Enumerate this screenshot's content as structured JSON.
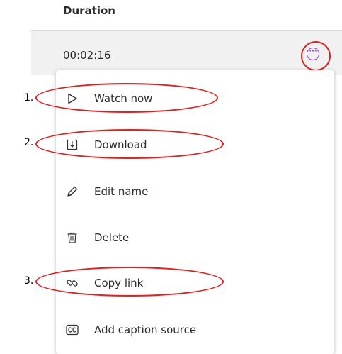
{
  "table": {
    "column_header": "Duration",
    "row": {
      "duration": "00:02:16"
    }
  },
  "menu": {
    "items": [
      {
        "label": "Watch now",
        "icon": "play-icon"
      },
      {
        "label": "Download",
        "icon": "download-icon"
      },
      {
        "label": "Edit name",
        "icon": "pencil-icon"
      },
      {
        "label": "Delete",
        "icon": "trash-icon"
      },
      {
        "label": "Copy link",
        "icon": "link-icon"
      },
      {
        "label": "Add caption source",
        "icon": "closed-caption-icon"
      }
    ]
  },
  "annotations": {
    "steps": [
      "1.",
      "2.",
      "3."
    ],
    "highlight_color": "#e02020"
  },
  "colors": {
    "accent": "#9b3fc7",
    "row_background": "#f1f1f1",
    "text": "#2b2b2b"
  }
}
